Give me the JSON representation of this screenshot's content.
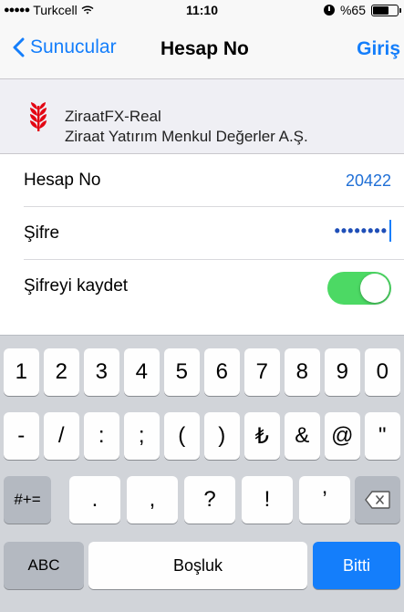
{
  "status": {
    "carrier": "Turkcell",
    "time": "11:10",
    "battery": "%65",
    "battery_level": 0.65
  },
  "nav": {
    "back_label": "Sunucular",
    "title": "Hesap No",
    "right_label": "Giriş"
  },
  "server": {
    "name": "ZiraatFX-Real",
    "company": "Ziraat Yatırım Menkul Değerler A.Ş."
  },
  "form": {
    "account_label": "Hesap No",
    "account_value": "20422",
    "password_label": "Şifre",
    "password_value": "••••••••",
    "save_password_label": "Şifreyi kaydet",
    "save_password_on": true
  },
  "keyboard": {
    "row1": [
      "1",
      "2",
      "3",
      "4",
      "5",
      "6",
      "7",
      "8",
      "9",
      "0"
    ],
    "row2": [
      "-",
      "/",
      ":",
      ";",
      "(",
      ")",
      "₺",
      "&",
      "@",
      "\""
    ],
    "row3_left": "#+=",
    "row3": [
      ".",
      ",",
      "?",
      "!",
      "’"
    ],
    "abc": "ABC",
    "space": "Boşluk",
    "done": "Bitti"
  },
  "colors": {
    "accent": "#147efb",
    "toggle_on": "#4cd964",
    "brand_red": "#e30613"
  }
}
